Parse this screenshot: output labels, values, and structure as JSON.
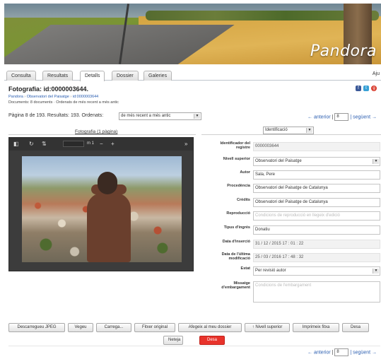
{
  "banner": {
    "logo_text": "Pandora"
  },
  "tabs": [
    {
      "label": "Consulta"
    },
    {
      "label": "Resultats"
    },
    {
      "label": "Detalls"
    },
    {
      "label": "Dossier"
    },
    {
      "label": "Galeries"
    }
  ],
  "tab_help": "Aju",
  "record": {
    "title": "Fotografia: id:0000003644.",
    "breadcrumb": [
      "Pandora",
      "Observatori del Paisatge",
      "id:0000003644"
    ],
    "doc_note": "Documents: 8 documents · Ordenats de més recent a més antic"
  },
  "pager": {
    "summary": "Pàgina 8 de 193. Resultats: 193. Ordenats:",
    "sort_value": "de més recent a més antic",
    "prev": "← anterior",
    "sep": "|",
    "page_value": "8",
    "next": "| següent →"
  },
  "photos_label": "Fotografia (1 pàgina)",
  "view_select": "Identificació",
  "viewer": {
    "zoom_pct": "m 1"
  },
  "fields": [
    {
      "label": "Identificador del registre",
      "value": "0000003644",
      "kind": "ro"
    },
    {
      "label": "Nivell superior",
      "value": "Observatori del Paisatge",
      "kind": "select"
    },
    {
      "label": "Autor",
      "value": "Sala, Pere",
      "kind": "input"
    },
    {
      "label": "Procedència",
      "value": "Observatori del Paisatge de Catalunya",
      "kind": "input"
    },
    {
      "label": "Crèdits",
      "value": "Observatori del Paisatge de Catalunya",
      "kind": "input"
    },
    {
      "label": "Reproducció",
      "value": "Condicions de reproducció en llegeix d'edició",
      "kind": "placeholder"
    },
    {
      "label": "Tipus d'ingrés",
      "value": "Donatiu",
      "kind": "input"
    },
    {
      "label": "Data d'inserció",
      "value": "31 / 12 / 2015 17 : 01 : 22",
      "kind": "ro"
    },
    {
      "label": "Data de l'última modificació",
      "value": "25 / 03 / 2016 17 : 48 : 32",
      "kind": "ro"
    },
    {
      "label": "Estat",
      "value": "Per revisió autor",
      "kind": "select"
    },
    {
      "label": "Missatge d'embargament",
      "value": "Condicions de l'embargament",
      "kind": "textarea"
    }
  ],
  "buttons": {
    "download": "Descarregueu JPEG",
    "view": "Vegeu",
    "upload": "Carrega...",
    "original": "Fitxer original",
    "add_dossier": "Afegeix al meu dossier",
    "parent": "↑ Nivell superior",
    "print": "Imprimeix fitxa",
    "save_as": "Desa",
    "reset": "Neteja",
    "submit": "Desa"
  }
}
